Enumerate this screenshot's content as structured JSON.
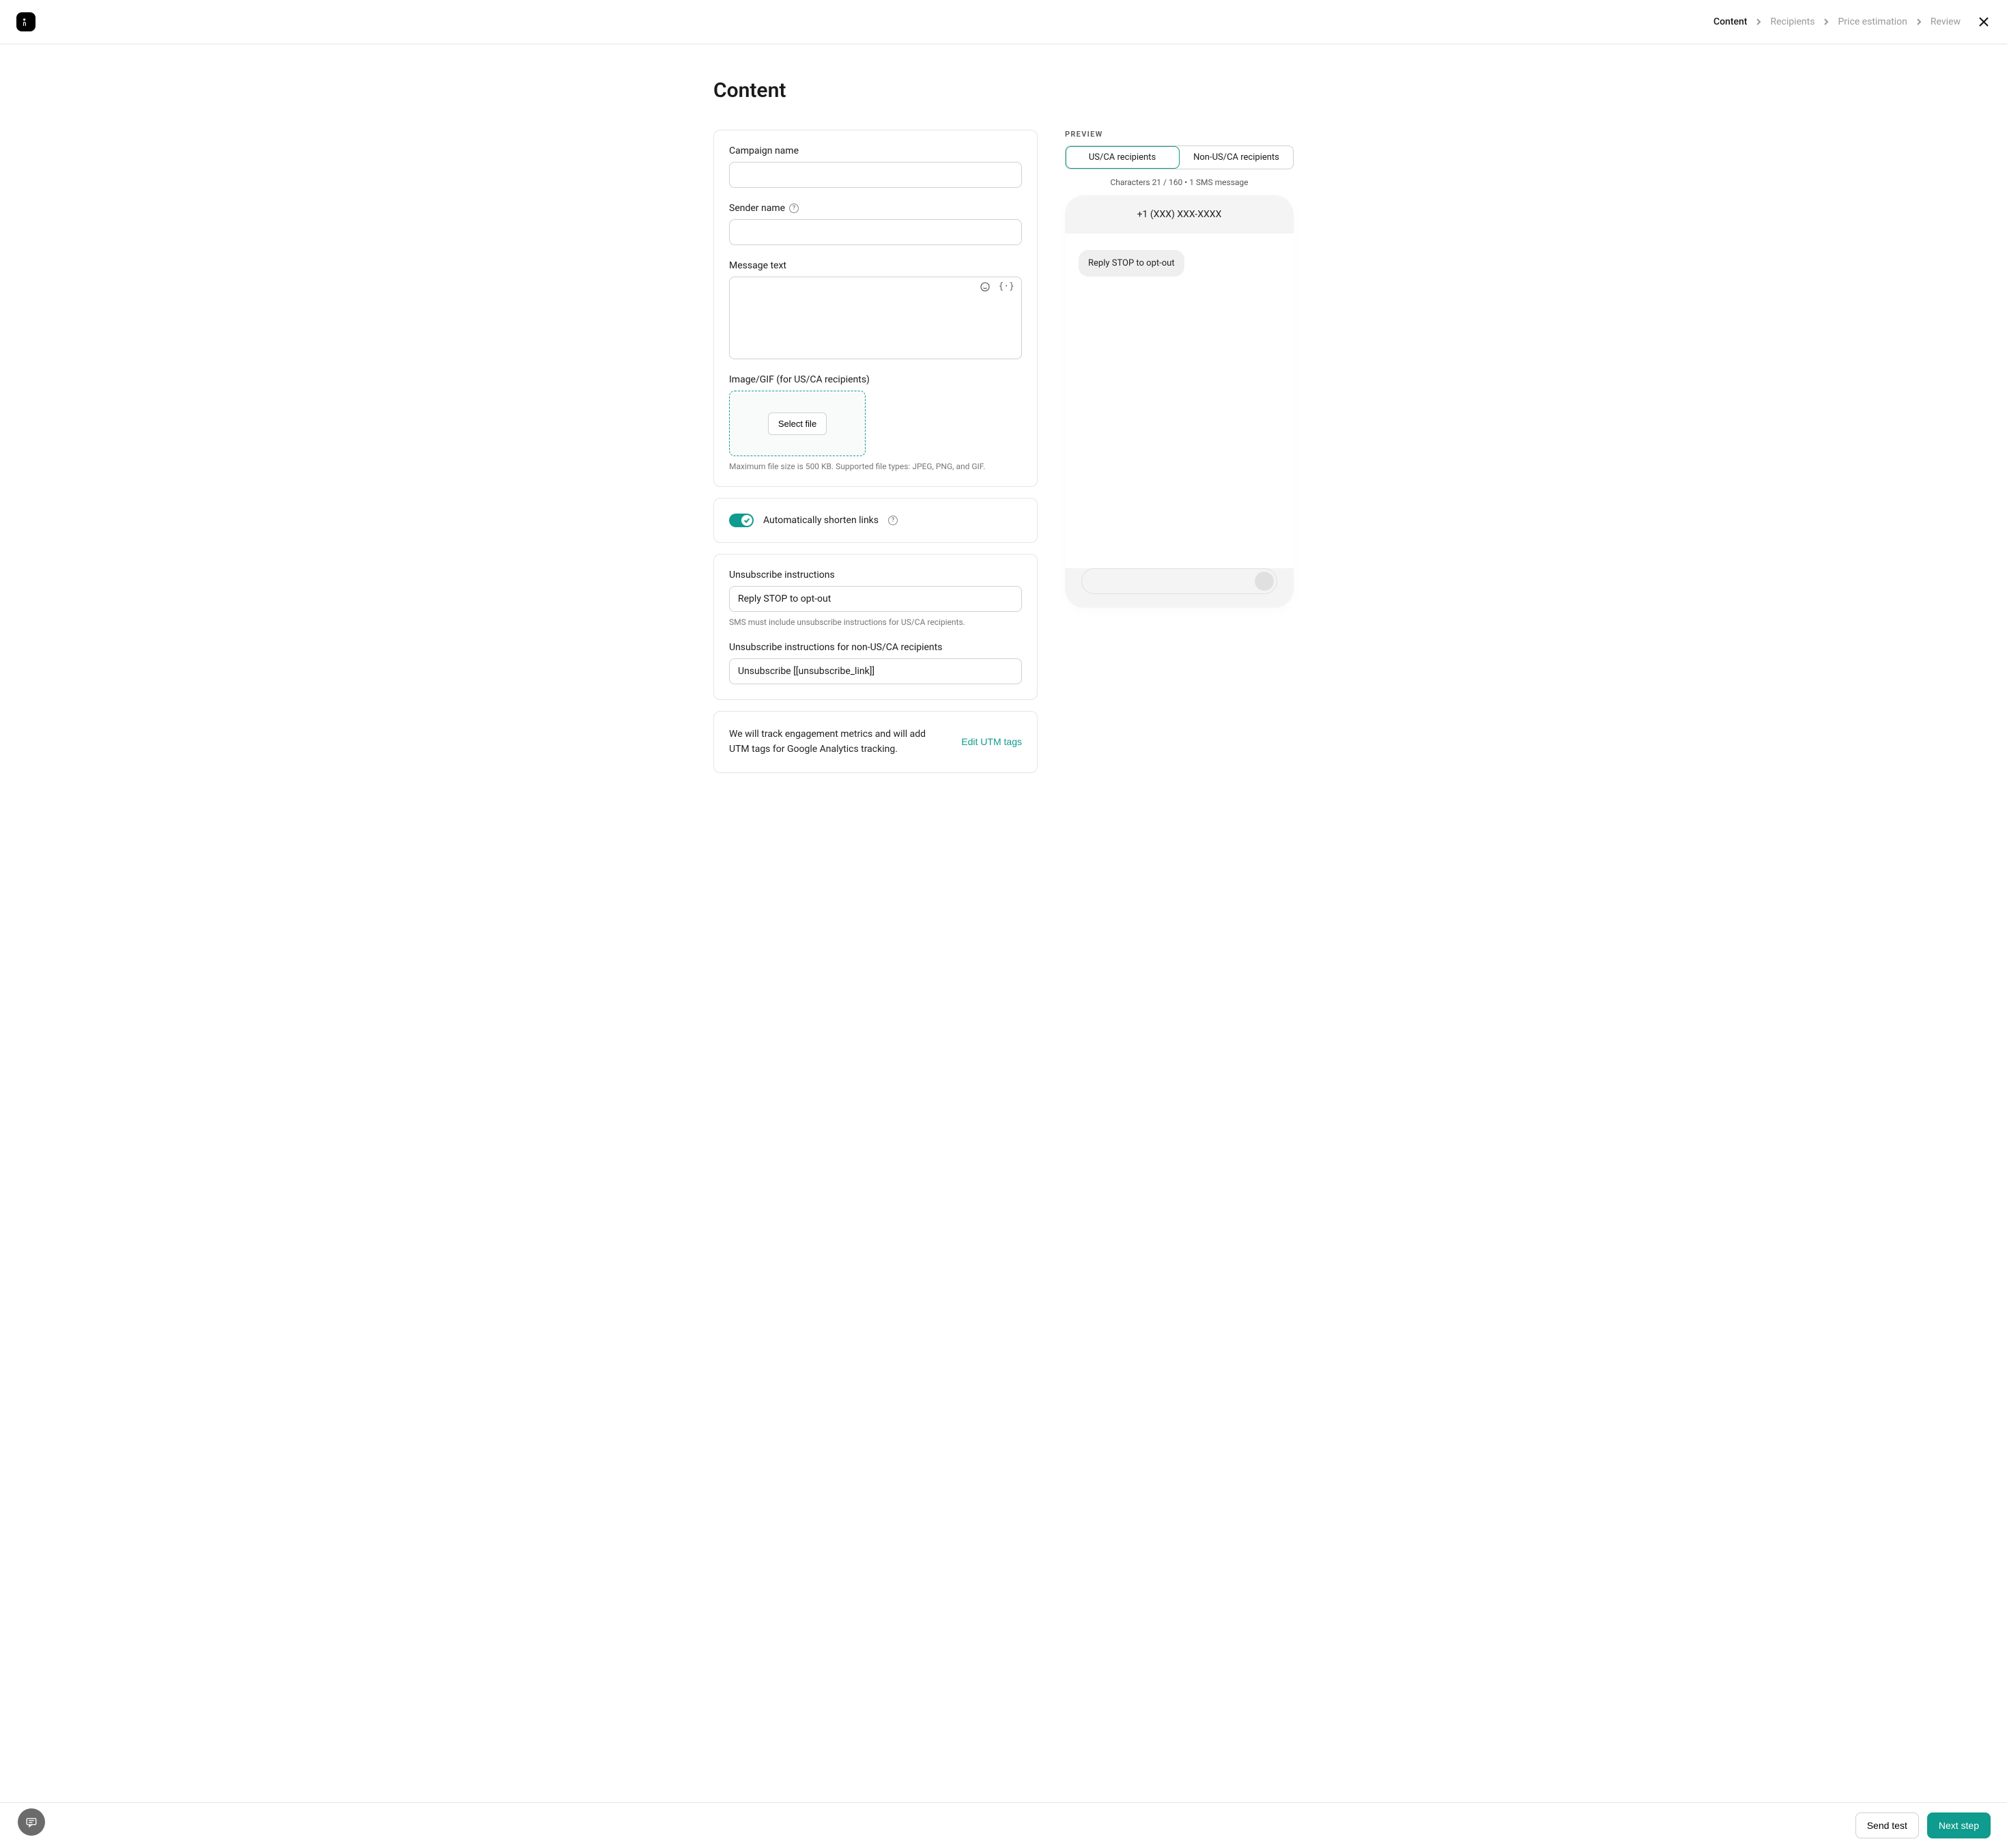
{
  "header": {
    "breadcrumb_steps": {
      "content": "Content",
      "recipients": "Recipients",
      "price_estimation": "Price estimation",
      "review": "Review"
    }
  },
  "page": {
    "title": "Content"
  },
  "form": {
    "campaign_name": {
      "label": "Campaign name",
      "value": ""
    },
    "sender_name": {
      "label": "Sender name",
      "value": ""
    },
    "message_text": {
      "label": "Message text",
      "value": ""
    },
    "image_upload": {
      "label": "Image/GIF (for US/CA recipients)",
      "button_label": "Select file",
      "hint": "Maximum file size is 500 KB. Supported file types: JPEG, PNG, and GIF."
    },
    "shorten_links": {
      "label": "Automatically shorten links",
      "enabled": true
    },
    "unsub": {
      "label": "Unsubscribe instructions",
      "value": "Reply STOP to opt-out",
      "hint": "SMS must include unsubscribe instructions for US/CA recipients."
    },
    "unsub_non_us": {
      "label": "Unsubscribe instructions for non-US/CA recipients",
      "value": "Unsubscribe [[unsubscribe_link]]"
    },
    "utm": {
      "description": "We will track engagement metrics and will add UTM tags for Google Analytics tracking.",
      "edit_label": "Edit UTM tags"
    }
  },
  "preview": {
    "heading": "PREVIEW",
    "tab_us": "US/CA recipients",
    "tab_non_us": "Non-US/CA recipients",
    "char_count_text": "Characters 21 / 160 • 1 SMS message",
    "phone_number": "+1 (XXX) XXX-XXXX",
    "bubble_text": "Reply STOP to opt-out"
  },
  "footer": {
    "send_test_label": "Send test",
    "next_label": "Next step"
  },
  "colors": {
    "accent": "#0f9b8e"
  }
}
